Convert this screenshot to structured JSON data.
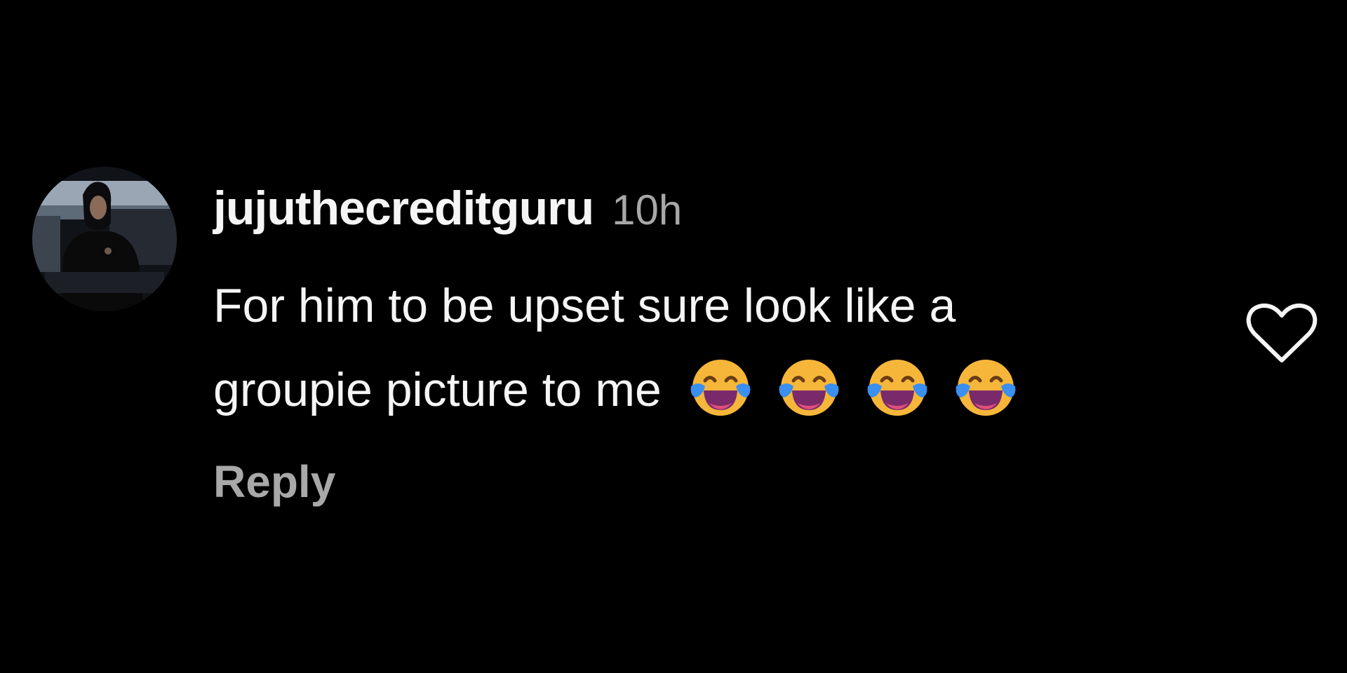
{
  "comment": {
    "avatar_icon": "profile-photo",
    "username": "jujuthecreditguru",
    "timestamp": "10h",
    "text_line_1": "For him to be upset sure look like a",
    "text_line_2": "groupie picture to me",
    "emojis": [
      "😂",
      "😂",
      "😂",
      "😂"
    ],
    "emoji_icon": "face-with-tears-of-joy-icon",
    "reply_label": "Reply",
    "like_icon": "heart-outline-icon"
  },
  "colors": {
    "background": "#000000",
    "primary_text": "#f5f5f5",
    "secondary_text": "#a8a8a8",
    "emoji_face": "#f6b63a",
    "emoji_tears": "#3a8ff0",
    "emoji_mouth": "#7a2a6a"
  }
}
